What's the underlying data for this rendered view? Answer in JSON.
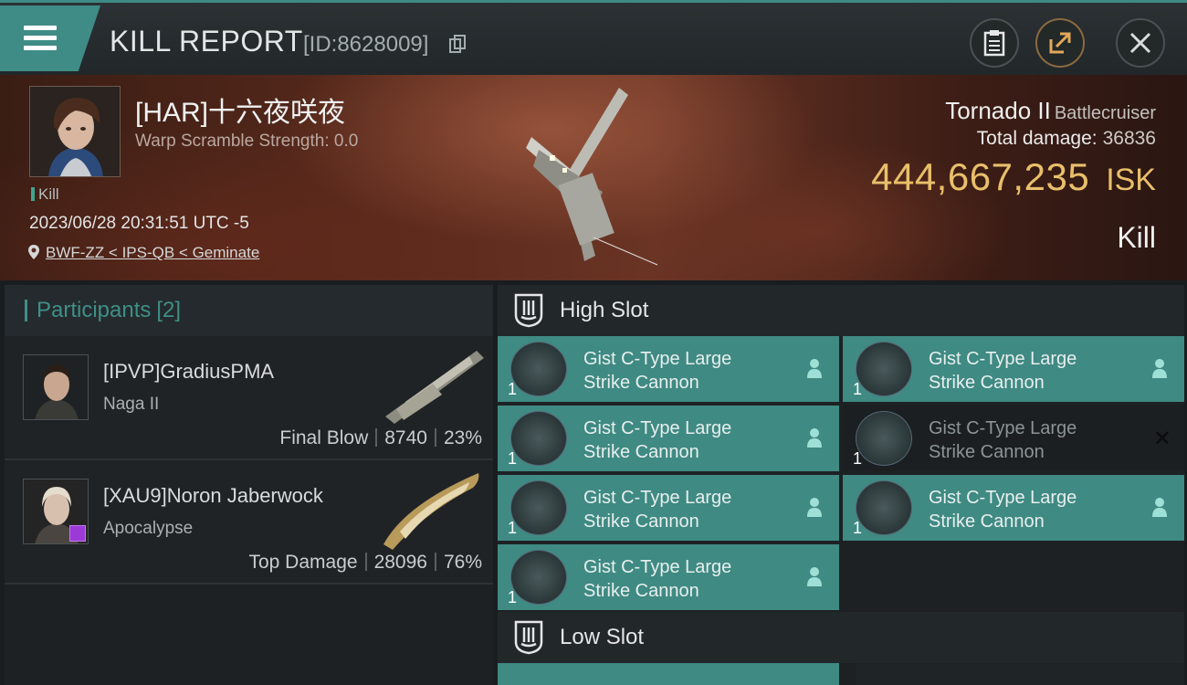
{
  "header": {
    "title": "KILL REPORT",
    "report_id": "[ID:8628009]"
  },
  "victim": {
    "name": "[HAR]十六夜咲夜",
    "scramble": "Warp Scramble Strength: 0.0",
    "tag": "Kill",
    "datetime": "2023/06/28 20:31:51 UTC -5",
    "location": "BWF-ZZ < IPS-QB < Geminate",
    "ship": "Tornado II",
    "ship_class": "Battlecruiser",
    "total_damage_label": "Total damage:",
    "total_damage": "36836",
    "isk_value": "444,667,235",
    "isk_unit": "ISK",
    "result": "Kill"
  },
  "participants": {
    "label": "Participants",
    "count": "[2]",
    "items": [
      {
        "name": "[IPVP]GradiusPMA",
        "ship": "Naga II",
        "role": "Final Blow",
        "damage": "8740",
        "percent": "23%"
      },
      {
        "name": "[XAU9]Noron Jaberwock",
        "ship": "Apocalypse",
        "role": "Top Damage",
        "damage": "28096",
        "percent": "76%"
      }
    ]
  },
  "slots": {
    "high_title": "High Slot",
    "low_title": "Low Slot",
    "high_modules": [
      {
        "line1": "Gist C-Type Large",
        "line2": "Strike Cannon",
        "qty": "1"
      },
      {
        "line1": "Gist C-Type Large",
        "line2": "Strike Cannon",
        "qty": "1"
      },
      {
        "line1": "Gist C-Type Large",
        "line2": "Strike Cannon",
        "qty": "1"
      },
      {
        "line1": "Gist C-Type Large",
        "line2": "Strike Cannon",
        "qty": "1"
      },
      {
        "line1": "Gist C-Type Large",
        "line2": "Strike Cannon",
        "qty": "1"
      },
      {
        "line1": "Gist C-Type Large",
        "line2": "Strike Cannon",
        "qty": "1"
      },
      {
        "line1": "Gist C-Type Large",
        "line2": "Strike Cannon",
        "qty": "1"
      }
    ]
  },
  "colors": {
    "accent_teal": "#3f8a83",
    "isk_gold": "#e9bf6b"
  }
}
